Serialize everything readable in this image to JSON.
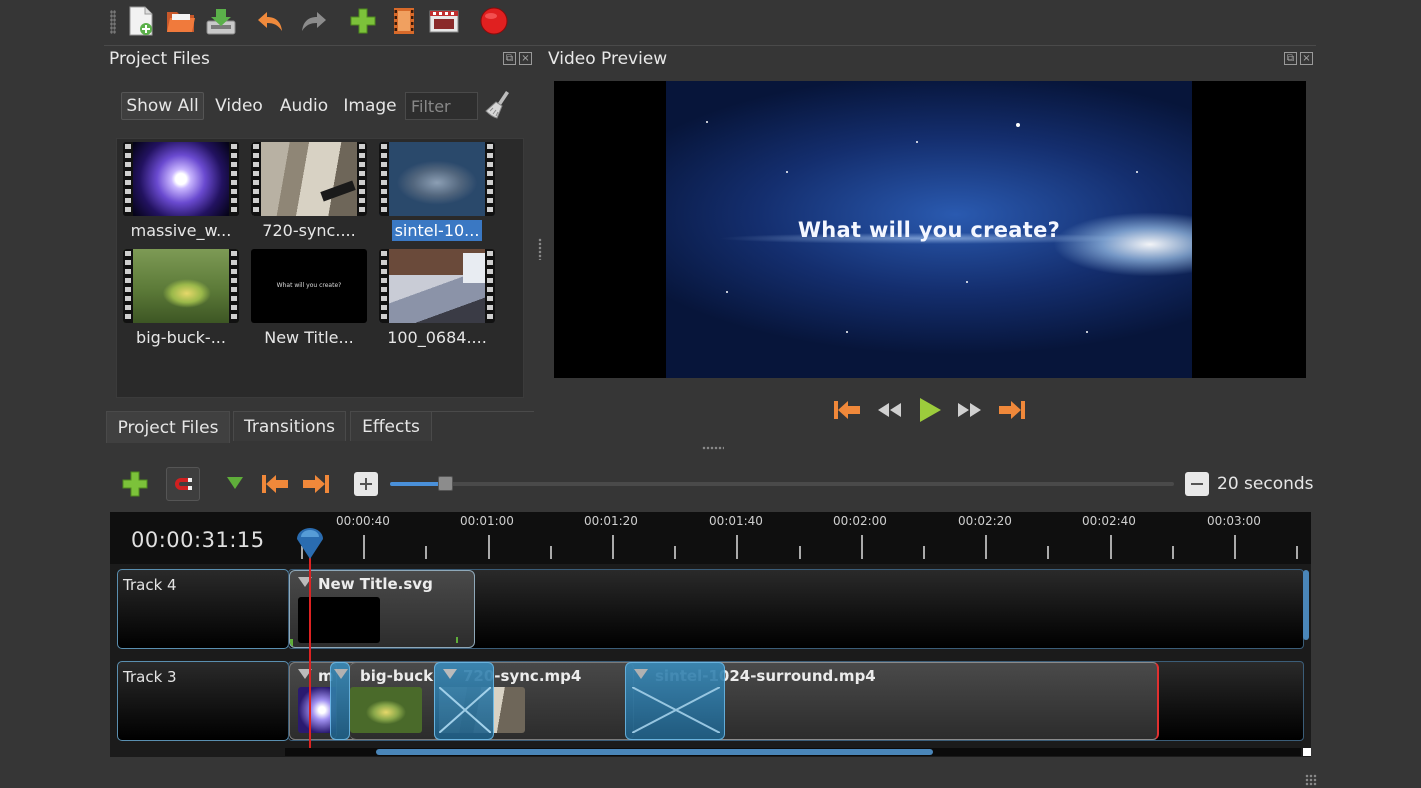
{
  "toolbar": {
    "items": [
      "new-project",
      "open-project",
      "save-project",
      "undo",
      "redo",
      "import-files",
      "profile",
      "export-video",
      "record"
    ]
  },
  "project_files": {
    "title": "Project Files",
    "filters": [
      "Show All",
      "Video",
      "Audio",
      "Image"
    ],
    "filter_placeholder": "Filter",
    "files": [
      {
        "name": "massive_w...",
        "selected": false
      },
      {
        "name": "720-sync....",
        "selected": false
      },
      {
        "name": "sintel-10...",
        "selected": true
      },
      {
        "name": "big-buck-...",
        "selected": false
      },
      {
        "name": "New Title...",
        "selected": false
      },
      {
        "name": "100_0684....",
        "selected": false
      }
    ],
    "title_thumb_text": "What will you create?"
  },
  "tabs": [
    "Project Files",
    "Transitions",
    "Effects"
  ],
  "video_preview": {
    "title": "Video Preview",
    "overlay_text": "What will you create?"
  },
  "timeline": {
    "zoom_label": "20 seconds",
    "zoom_level": 0.07,
    "timecode": "00:00:31:15",
    "ruler_labels": [
      "00:00:40",
      "00:01:00",
      "00:01:20",
      "00:01:40",
      "00:02:00",
      "00:02:20",
      "00:02:40",
      "00:03:00"
    ],
    "tracks": [
      {
        "name": "Track 4",
        "clips": [
          {
            "title": "New Title.svg"
          }
        ]
      },
      {
        "name": "Track 3",
        "clips": [
          {
            "title": "m"
          },
          {
            "title": "big-buck-"
          },
          {
            "title": "720-sync.mp4"
          },
          {
            "title": "sintel-1024-surround.mp4"
          }
        ]
      }
    ]
  },
  "colors": {
    "accent": "#3a78c3",
    "playhead": "#dd2222",
    "selected_clip": "#3a89b7",
    "record": "#e02020",
    "play": "#9ccc3c",
    "skip": "#f0883a"
  }
}
